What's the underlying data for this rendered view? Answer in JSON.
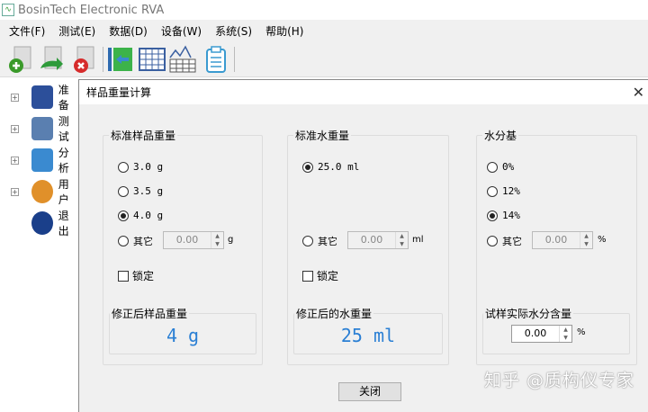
{
  "app": {
    "title": "BosinTech Electronic RVA"
  },
  "menu": [
    "文件(F)",
    "测试(E)",
    "数据(D)",
    "设备(W)",
    "系统(S)",
    "帮助(H)"
  ],
  "tree": [
    {
      "label": "准备",
      "color": "#2c4f9a"
    },
    {
      "label": "测试",
      "color": "#5a7fb0"
    },
    {
      "label": "分析",
      "color": "#3a8ad0"
    },
    {
      "label": "用户",
      "color": "#e0902a"
    },
    {
      "label": "退出",
      "color": "#1a3f8a"
    }
  ],
  "dialog": {
    "title": "样品重量计算",
    "close_label": "关闭",
    "sample": {
      "label": "标准样品重量",
      "options": [
        "3.0 g",
        "3.5 g",
        "4.0 g"
      ],
      "selected": 2,
      "other_label": "其它",
      "other_value": "0.00",
      "unit": "g",
      "lock_label": "锁定",
      "result_label": "修正后样品重量",
      "result": "4 g"
    },
    "water": {
      "label": "标准水重量",
      "options": [
        "25.0 ml"
      ],
      "selected": 0,
      "other_label": "其它",
      "other_value": "0.00",
      "unit": "ml",
      "lock_label": "锁定",
      "result_label": "修正后的水重量",
      "result": "25 ml"
    },
    "moisture": {
      "label": "水分基",
      "options": [
        "0%",
        "12%",
        "14%"
      ],
      "selected": 2,
      "other_label": "其它",
      "other_value": "0.00",
      "unit": "%",
      "result_label": "试样实际水分含量",
      "result_value": "0.00",
      "result_unit": "%"
    }
  },
  "watermark": "知乎 @质构仪专家",
  "colors": {
    "result": "#2a7fd4"
  }
}
